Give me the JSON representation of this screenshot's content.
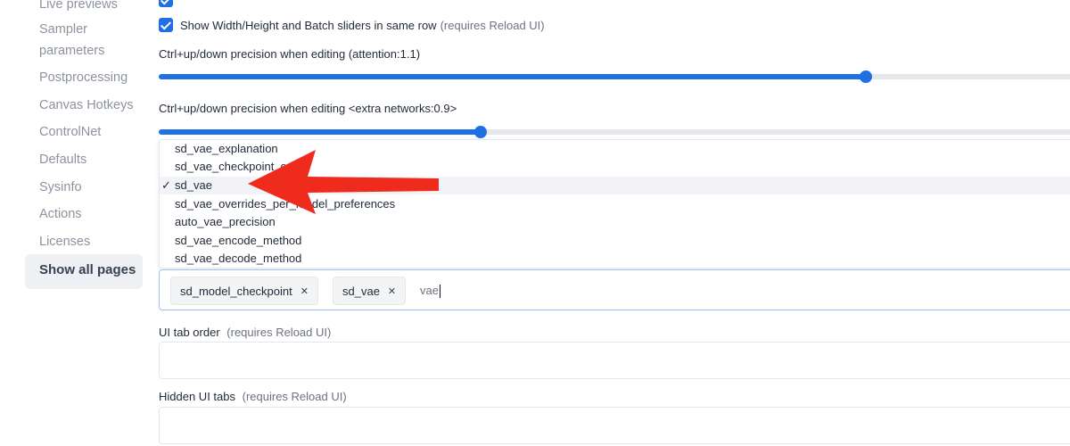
{
  "sidebar": {
    "items": [
      {
        "label": "Live previews"
      },
      {
        "label": "Sampler"
      },
      {
        "label": "parameters"
      },
      {
        "label": "Postprocessing"
      },
      {
        "label": "Canvas Hotkeys"
      },
      {
        "label": "ControlNet"
      },
      {
        "label": "Defaults"
      },
      {
        "label": "Sysinfo"
      },
      {
        "label": "Actions"
      },
      {
        "label": "Licenses"
      }
    ],
    "active": {
      "label": "Show all pages"
    }
  },
  "settings": {
    "checkbox": {
      "label": "Show Width/Height and Batch sliders in same row",
      "hint": "(requires Reload UI)",
      "checked": true
    },
    "slider_attention": {
      "label": "Ctrl+up/down precision when editing (attention:1.1)",
      "value_fraction": 0.77
    },
    "slider_extra": {
      "label": "Ctrl+up/down precision when editing <extra networks:0.9>",
      "value_fraction": 0.35
    },
    "dropdown": {
      "options": [
        {
          "label": "sd_vae_explanation"
        },
        {
          "label": "sd_vae_checkpoint_ca"
        },
        {
          "label": "sd_vae",
          "checkmark": "✓",
          "selected": true
        },
        {
          "label": "sd_vae_overrides_per_model_preferences"
        },
        {
          "label": "auto_vae_precision"
        },
        {
          "label": "sd_vae_encode_method"
        },
        {
          "label": "sd_vae_decode_method"
        }
      ]
    },
    "multiselect": {
      "chips": [
        {
          "label": "sd_model_checkpoint",
          "remove": "✕"
        },
        {
          "label": "sd_vae",
          "remove": "✕"
        }
      ],
      "typed": "vae"
    },
    "tab_order": {
      "label": "UI tab order",
      "hint": "(requires Reload UI)",
      "value": ""
    },
    "hidden_tabs": {
      "label": "Hidden UI tabs",
      "hint": "(requires Reload UI)",
      "value": ""
    }
  },
  "colors": {
    "accent": "#1f6fe5",
    "annotation_arrow": "#ef2b1e",
    "sidebar_text": "#8c939e"
  },
  "icons": {
    "checkbox": "check-icon",
    "chip_remove": "close-icon",
    "annotation": "red-arrow-icon"
  }
}
